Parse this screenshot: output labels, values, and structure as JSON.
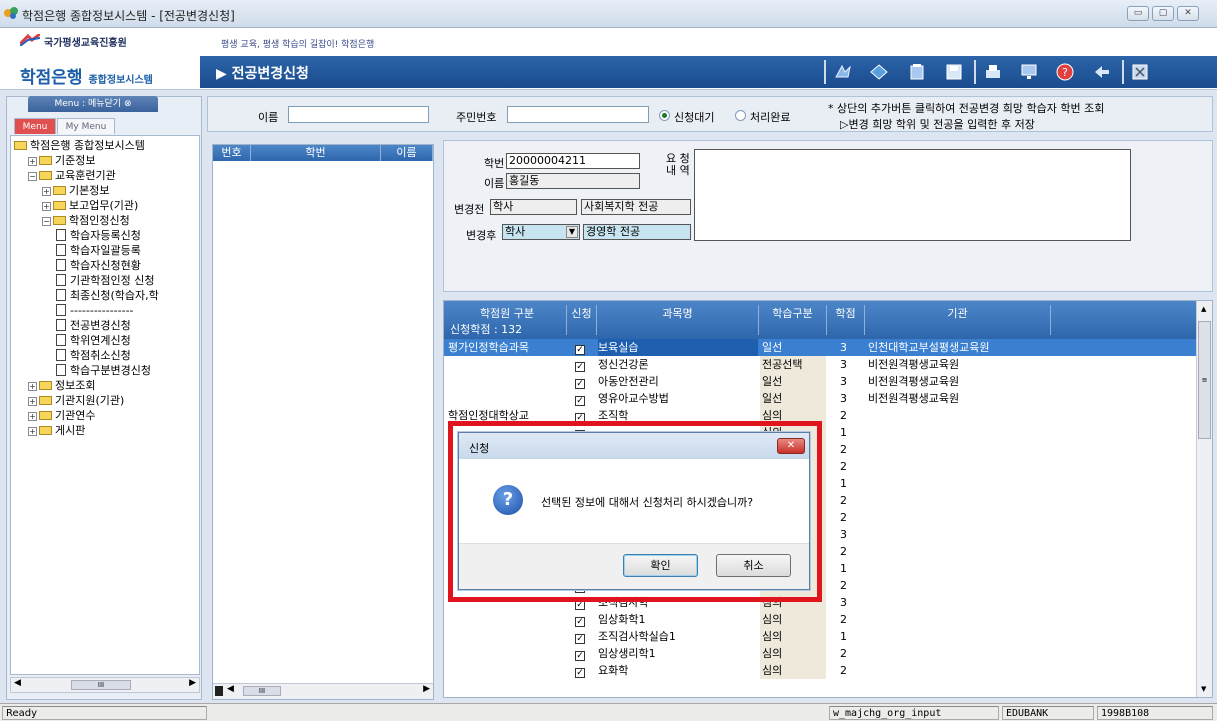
{
  "window": {
    "title": "학점은행 종합정보시스템 - [전공변경신청]",
    "controls": [
      "▭",
      "▢",
      "✕"
    ]
  },
  "header": {
    "org_logo": "국가평생교육진흥원",
    "slogan": "평생 교육, 평생 학습의 길잡이! 학점은행",
    "app_logo_main": "학점은행",
    "app_logo_sub": "종합정보시스템",
    "page_title": "▶ 전공변경신청"
  },
  "menu": {
    "title": "Menu : 메뉴닫기 ⊗",
    "tabs": [
      "Menu",
      "My Menu"
    ],
    "tree": [
      {
        "label": "학점은행 종합정보시스템",
        "type": "folder",
        "level": 0,
        "pm": ""
      },
      {
        "label": "기준정보",
        "type": "folder",
        "level": 1,
        "pm": "+"
      },
      {
        "label": "교육훈련기관",
        "type": "folder",
        "level": 1,
        "pm": "−"
      },
      {
        "label": "기본정보",
        "type": "folder",
        "level": 2,
        "pm": "+"
      },
      {
        "label": "보고업무(기관)",
        "type": "folder",
        "level": 2,
        "pm": "+"
      },
      {
        "label": "학점인정신청",
        "type": "folder",
        "level": 2,
        "pm": "−"
      },
      {
        "label": "학습자등록신청",
        "type": "doc",
        "level": 3,
        "pm": ""
      },
      {
        "label": "학습자일괄등록",
        "type": "doc",
        "level": 3,
        "pm": ""
      },
      {
        "label": "학습자신청현황",
        "type": "doc",
        "level": 3,
        "pm": ""
      },
      {
        "label": "기관학점인정 신청",
        "type": "doc",
        "level": 3,
        "pm": ""
      },
      {
        "label": "최종신청(학습자,학",
        "type": "doc",
        "level": 3,
        "pm": ""
      },
      {
        "label": "----------------",
        "type": "doc",
        "level": 3,
        "pm": ""
      },
      {
        "label": "전공변경신청",
        "type": "doc",
        "level": 3,
        "pm": ""
      },
      {
        "label": "학위연계신청",
        "type": "doc",
        "level": 3,
        "pm": ""
      },
      {
        "label": "학점취소신청",
        "type": "doc",
        "level": 3,
        "pm": ""
      },
      {
        "label": "학습구분변경신청",
        "type": "doc",
        "level": 3,
        "pm": ""
      },
      {
        "label": "정보조회",
        "type": "folder",
        "level": 1,
        "pm": "+"
      },
      {
        "label": "기관지원(기관)",
        "type": "folder",
        "level": 1,
        "pm": "+"
      },
      {
        "label": "기관연수",
        "type": "folder",
        "level": 1,
        "pm": "+"
      },
      {
        "label": "게시판",
        "type": "folder",
        "level": 1,
        "pm": "+"
      }
    ]
  },
  "search": {
    "name_label": "이름",
    "name_value": "",
    "id_label": "주민번호",
    "id_value": "",
    "radio_pending": "신청대기",
    "radio_done": "처리완료",
    "note_line1": "* 상단의 추가버튼 클릭하여 전공변경 희망 학습자 학번 조회",
    "note_line2": "▷변경 희망 학위 및 전공을 입력한 후 저장"
  },
  "list": {
    "columns": [
      "번호",
      "학번",
      "이름"
    ]
  },
  "detail": {
    "student_no_label": "학번",
    "student_no": "20000004211",
    "name_label": "이름",
    "name": "홍길동",
    "request_label_1": "요 청",
    "request_label_2": "내 역",
    "before_label": "변경전",
    "before_degree": "학사",
    "before_major": "사회복지학 전공",
    "after_label": "변경후",
    "after_degree": "학사",
    "after_major": "경영학 전공"
  },
  "grid": {
    "col_category_1": "학점원 구분",
    "col_category_2": "신청학점 : 132",
    "columns": [
      "신청",
      "과목명",
      "학습구분",
      "학점",
      "기관"
    ],
    "rows": [
      {
        "category": "평가인정학습과목",
        "checked": true,
        "subject": "보육실습",
        "type": "일선",
        "credit": "3",
        "org": "인천대학교부설평생교육원",
        "selected": true
      },
      {
        "category": "",
        "checked": true,
        "subject": "정신건강론",
        "type": "전공선택",
        "credit": "3",
        "org": "비전원격평생교육원"
      },
      {
        "category": "",
        "checked": true,
        "subject": "아동안전관리",
        "type": "일선",
        "credit": "3",
        "org": "비전원격평생교육원"
      },
      {
        "category": "",
        "checked": true,
        "subject": "영유아교수방법",
        "type": "일선",
        "credit": "3",
        "org": "비전원격평생교육원"
      },
      {
        "category": "학점인정대학상교",
        "checked": true,
        "subject": "조직학",
        "type": "심의",
        "credit": "2",
        "org": ""
      },
      {
        "category": "",
        "checked": true,
        "subject": "",
        "type": "심의",
        "credit": "1",
        "org": ""
      },
      {
        "category": "",
        "checked": true,
        "subject": "",
        "type": "",
        "credit": "2",
        "org": ""
      },
      {
        "category": "",
        "checked": true,
        "subject": "",
        "type": "",
        "credit": "2",
        "org": ""
      },
      {
        "category": "",
        "checked": true,
        "subject": "",
        "type": "",
        "credit": "1",
        "org": ""
      },
      {
        "category": "",
        "checked": true,
        "subject": "",
        "type": "",
        "credit": "2",
        "org": ""
      },
      {
        "category": "",
        "checked": true,
        "subject": "",
        "type": "",
        "credit": "2",
        "org": ""
      },
      {
        "category": "",
        "checked": true,
        "subject": "",
        "type": "",
        "credit": "3",
        "org": ""
      },
      {
        "category": "",
        "checked": true,
        "subject": "",
        "type": "",
        "credit": "2",
        "org": ""
      },
      {
        "category": "",
        "checked": true,
        "subject": "",
        "type": "",
        "credit": "1",
        "org": ""
      },
      {
        "category": "",
        "checked": true,
        "subject": "임상화학1",
        "type": "심의",
        "credit": "2",
        "org": ""
      },
      {
        "category": "",
        "checked": true,
        "subject": "조직검사학",
        "type": "심의",
        "credit": "3",
        "org": ""
      },
      {
        "category": "",
        "checked": true,
        "subject": "임상화학1",
        "type": "심의",
        "credit": "2",
        "org": ""
      },
      {
        "category": "",
        "checked": true,
        "subject": "조직검사학실습1",
        "type": "심의",
        "credit": "1",
        "org": ""
      },
      {
        "category": "",
        "checked": true,
        "subject": "임상생리학1",
        "type": "심의",
        "credit": "2",
        "org": ""
      },
      {
        "category": "",
        "checked": true,
        "subject": "요화학",
        "type": "심의",
        "credit": "2",
        "org": ""
      }
    ]
  },
  "dialog": {
    "title": "신청",
    "message": "선택된 정보에 대해서 신청처리 하시겠습니까?",
    "ok": "확인",
    "cancel": "취소",
    "icon": "?"
  },
  "status": {
    "left": "Ready",
    "window_name": "w_majchg_org_input",
    "org": "EDUBANK",
    "user": "1998B108",
    "hscroll_mark": "III"
  },
  "colors": {
    "accent": "#1a4c8e",
    "selected_row": "#3a7fd0",
    "highlight": "#e0141c"
  }
}
